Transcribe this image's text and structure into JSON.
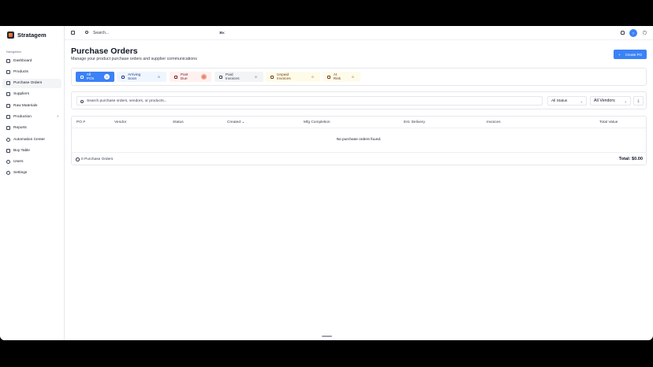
{
  "app": {
    "name": "Stratagem"
  },
  "sidebar": {
    "caption": "Navigation",
    "items": [
      {
        "label": "Dashboard",
        "icon": "dashboard-icon"
      },
      {
        "label": "Products",
        "icon": "box-icon"
      },
      {
        "label": "Purchase Orders",
        "icon": "cart-icon",
        "active": true
      },
      {
        "label": "Suppliers",
        "icon": "truck-icon"
      },
      {
        "label": "Raw Materials",
        "icon": "layers-icon"
      },
      {
        "label": "Production",
        "icon": "wrench-icon",
        "expandable": true
      },
      {
        "label": "Reports",
        "icon": "chart-icon"
      },
      {
        "label": "Automation Center",
        "icon": "automation-icon"
      },
      {
        "label": "Buy Table",
        "icon": "table-icon"
      },
      {
        "label": "Users",
        "icon": "users-icon"
      },
      {
        "label": "Settings",
        "icon": "gear-icon"
      }
    ]
  },
  "topbar": {
    "search_placeholder": "Search...",
    "shortcut": "⌘K",
    "avatar_initial": "T"
  },
  "page": {
    "title": "Purchase Orders",
    "subtitle": "Manage your product purchase orders and supplier communications",
    "create_label": "Create PO",
    "create_icon": "+"
  },
  "filters": {
    "all": {
      "label": "All POs",
      "count": "0"
    },
    "arriving": {
      "label": "Arriving Soon",
      "count": "0"
    },
    "past_due": {
      "label": "Past Due",
      "count": "0"
    },
    "paid": {
      "label": "Paid Invoices",
      "count": "0"
    },
    "unpaid": {
      "label": "Unpaid Invoices",
      "count": "0"
    },
    "risk": {
      "label": "At Risk",
      "count": "0"
    }
  },
  "search": {
    "placeholder": "Search purchase orders, vendors, or products...",
    "status_value": "All Status",
    "vendor_value": "All Vendors"
  },
  "table": {
    "columns": [
      "PO #",
      "Vendor",
      "Status",
      "Created",
      "Mfg Completion",
      "Est. Delivery",
      "Invoices",
      "Total Value"
    ],
    "empty_text": "No purchase orders found.",
    "footer_count": "0 Purchase Orders",
    "footer_total": "Total: $0.00"
  },
  "colors": {
    "accent": "#3b82f6",
    "past_due_badge": "#f4a08a"
  }
}
